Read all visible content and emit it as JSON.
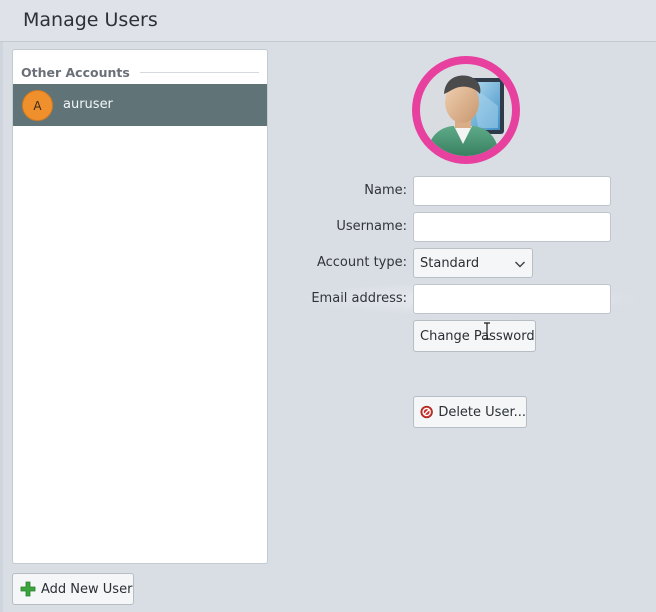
{
  "header": {
    "title": "Manage Users"
  },
  "accounts": {
    "section_label": "Other Accounts",
    "items": [
      {
        "initial": "A",
        "name": "auruser",
        "avatar_color": "#f0902c",
        "selected": true
      }
    ],
    "add_button_label": "Add New User",
    "add_button_icon": "plus-icon"
  },
  "details": {
    "photo_icon": "user-avatar-icon",
    "name_label": "Name:",
    "name_value": "",
    "username_label": "Username:",
    "username_value": "",
    "account_type_label": "Account type:",
    "account_type_value": "Standard",
    "email_label": "Email address:",
    "email_value": "",
    "change_password_label": "Change Password",
    "delete_user_label": "Delete User...",
    "delete_icon": "no-entry-icon"
  },
  "colors": {
    "selection": "#607477",
    "photo_ring": "#e8409e",
    "add_icon": "#3aa53a",
    "delete_icon": "#c9302c"
  }
}
